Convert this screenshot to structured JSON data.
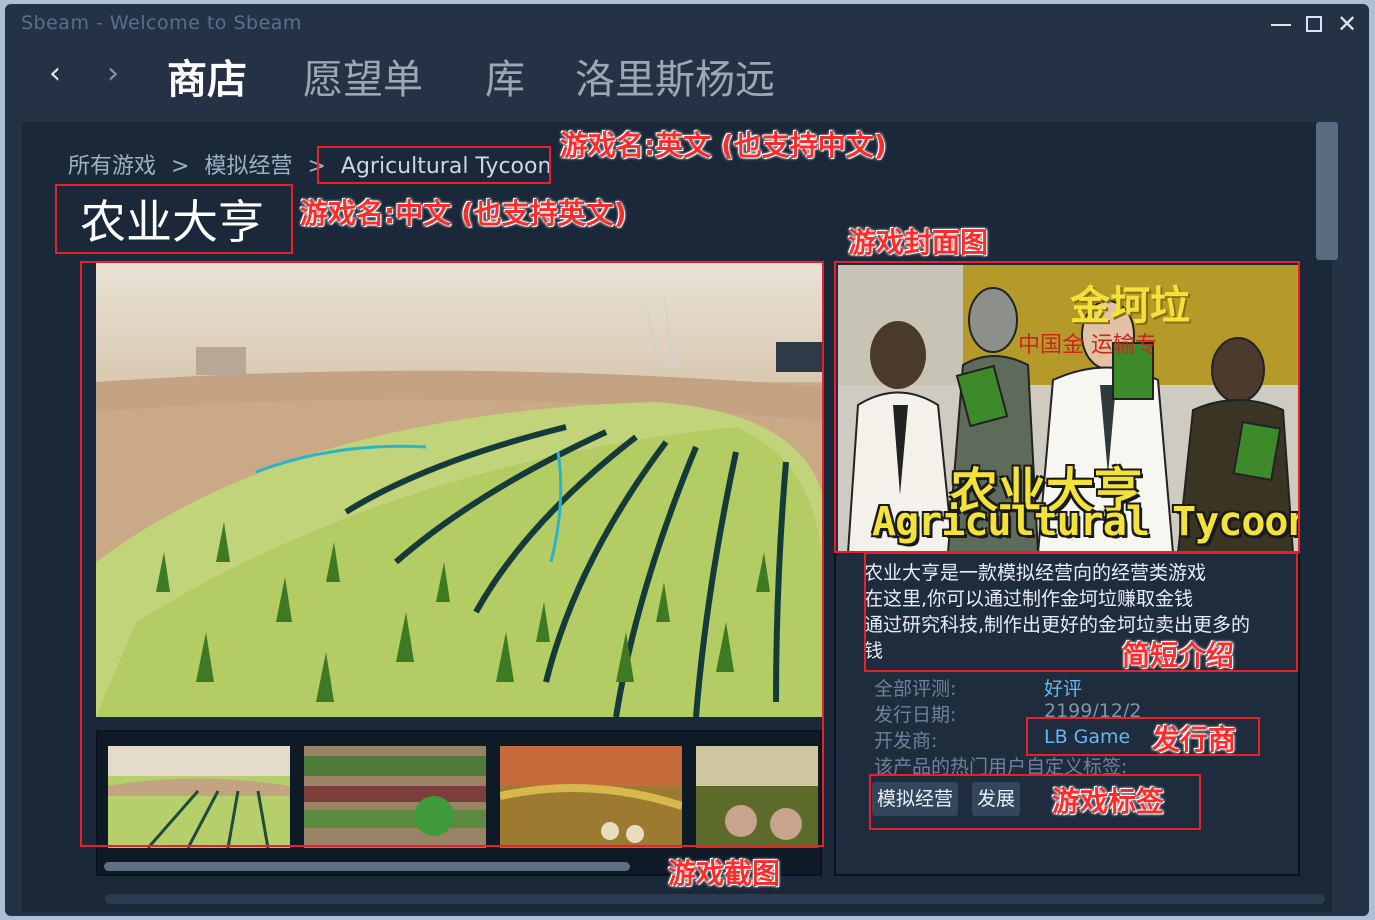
{
  "window": {
    "title": "Sbeam - Welcome to Sbeam",
    "minimize_icon": "minimize-icon",
    "maximize_icon": "maximize-icon",
    "close_icon": "close-icon",
    "close_glyph": "✕"
  },
  "nav": {
    "back_glyph": "‹",
    "forward_glyph": "›",
    "items": [
      "商店",
      "愿望单",
      "库",
      "洛里斯杨远"
    ],
    "active_index": 0
  },
  "breadcrumb": {
    "items": [
      "所有游戏",
      ">",
      "模拟经营",
      ">"
    ],
    "current": "Agricultural Tycoon"
  },
  "game": {
    "title_cn": "农业大亨",
    "description_lines": [
      "农业大亨是一款模拟经营向的经营类游戏",
      "在这里,你可以通过制作金坷垃赚取金钱",
      "通过研究科技,制作出更好的金坷垃卖出更多的",
      "钱"
    ],
    "cover": {
      "sign_text": "金坷垃",
      "sub_text": "中国金  运输专",
      "title_cn": "农业大亨",
      "title_en": "Agricultural Tycoon"
    },
    "meta": {
      "reviews_label": "全部评测:",
      "reviews_value": "好评",
      "release_label": "发行日期:",
      "release_value": "2199/12/2",
      "developer_label": "开发商:",
      "developer_value": "LB Game",
      "tags_label": "该产品的热门用户自定义标签:"
    },
    "tags": [
      "模拟经营",
      "发展"
    ]
  },
  "annotations": {
    "name_en": "游戏名:英文 (也支持中文)",
    "name_cn": "游戏名:中文 (也支持英文)",
    "cover": "游戏封面图",
    "description": "简短介绍",
    "publisher": "发行商",
    "tags": "游戏标签",
    "screenshots": "游戏截图"
  },
  "colors": {
    "annotation_red": "#e8202a",
    "link_blue": "#66b7f0",
    "window_bg": "#253245",
    "content_bg": "#1a2839",
    "cover_title_yellow": "#f2e23a"
  }
}
